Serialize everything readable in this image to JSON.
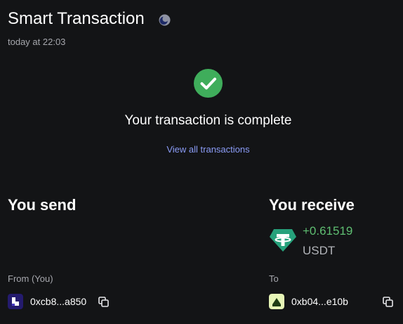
{
  "header": {
    "title": "Smart Transaction",
    "timestamp": "today at 22:03",
    "status_icon": "pending-moon-icon"
  },
  "result": {
    "icon": "check-circle-icon",
    "message": "Your transaction is complete",
    "view_all_link": "View all transactions"
  },
  "send": {
    "heading": "You send",
    "from_label": "From (You)",
    "from_address": "0xcb8...a850",
    "avatar_icon": "account-avatar-icon",
    "copy_icon": "copy-icon"
  },
  "receive": {
    "heading": "You receive",
    "amount": "+0.61519",
    "symbol": "USDT",
    "token_icon": "usdt-token-icon",
    "to_label": "To",
    "to_address": "0xb04...e10b",
    "avatar_icon": "recipient-avatar-icon",
    "copy_icon": "copy-icon"
  },
  "colors": {
    "background": "#131416",
    "success_green": "#3fad5b",
    "amount_green": "#5fbf72",
    "link_blue": "#8b9cf7",
    "muted_text": "#a6a7ad",
    "usdt_teal": "#26a17b"
  }
}
